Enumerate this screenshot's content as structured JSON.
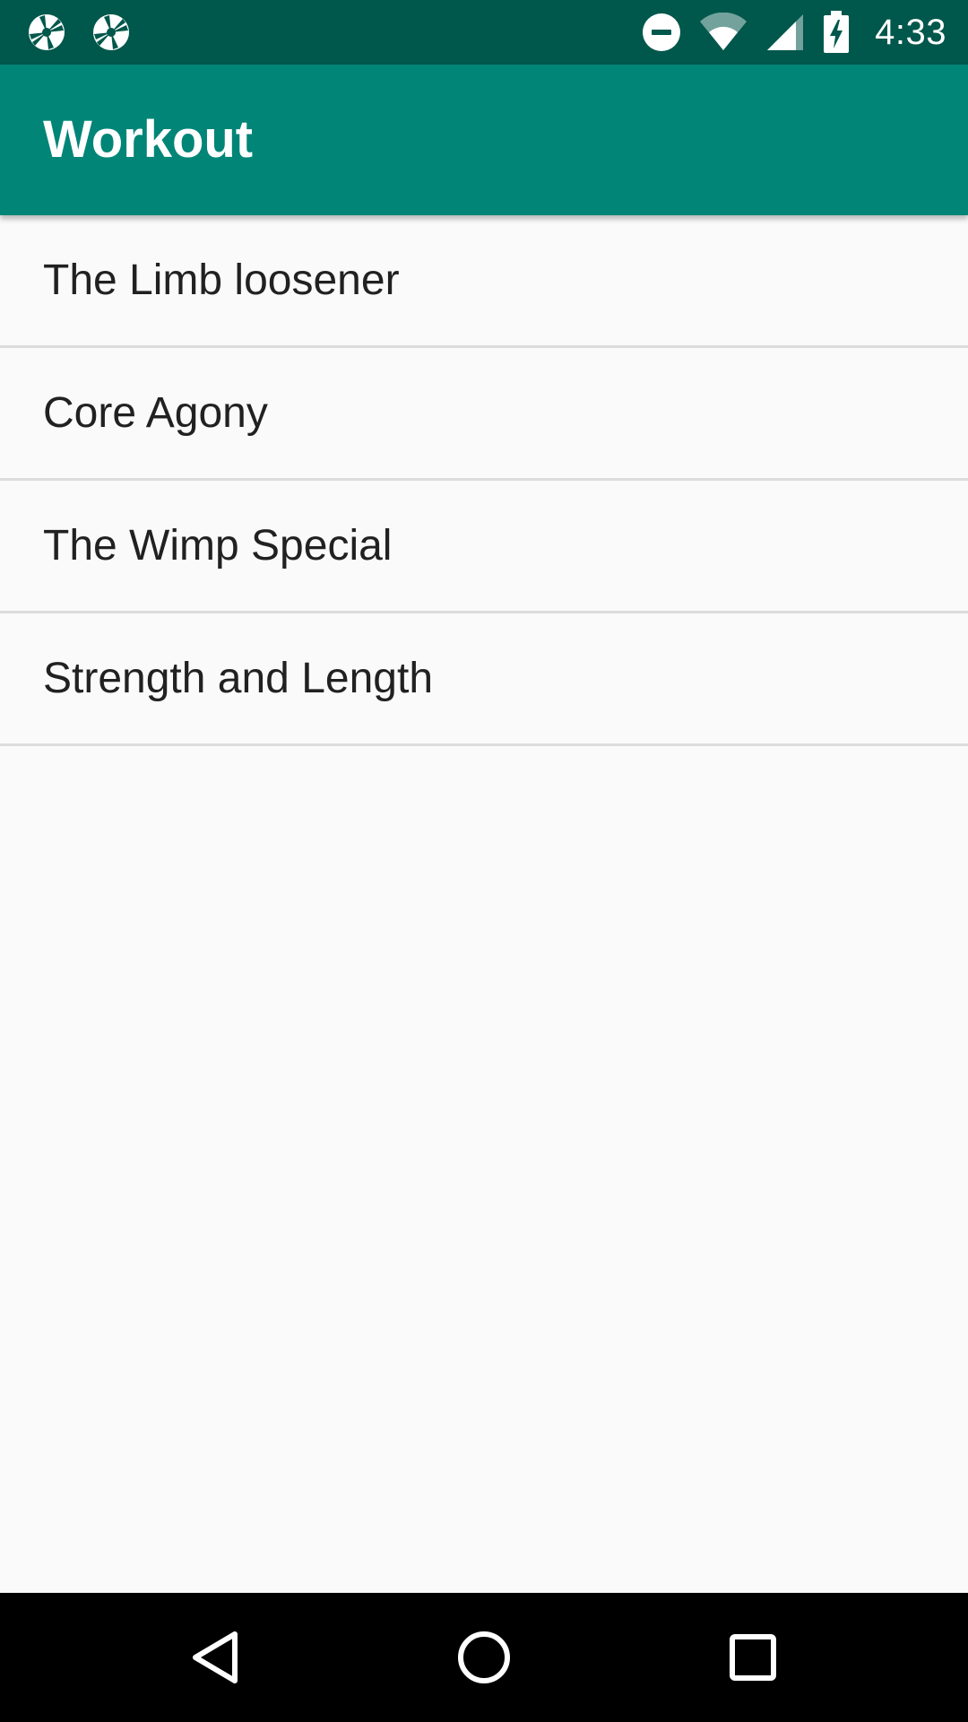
{
  "status_bar": {
    "time": "4:33",
    "left_icons": [
      "aperture-icon",
      "aperture-icon"
    ],
    "right_icons": [
      "do-not-disturb-icon",
      "wifi-icon",
      "cellular-signal-icon",
      "battery-charging-icon"
    ]
  },
  "app_bar": {
    "title": "Workout",
    "color": "#008577"
  },
  "workouts": [
    {
      "label": "The Limb loosener"
    },
    {
      "label": "Core Agony"
    },
    {
      "label": "The Wimp Special"
    },
    {
      "label": "Strength and Length"
    }
  ],
  "nav_bar": {
    "buttons": [
      "back-icon",
      "home-icon",
      "recents-icon"
    ]
  },
  "colors": {
    "status_bar": "#00574b",
    "app_bar": "#008577",
    "background": "#fafafa",
    "text": "#212121",
    "divider": "#dcdcdc"
  }
}
